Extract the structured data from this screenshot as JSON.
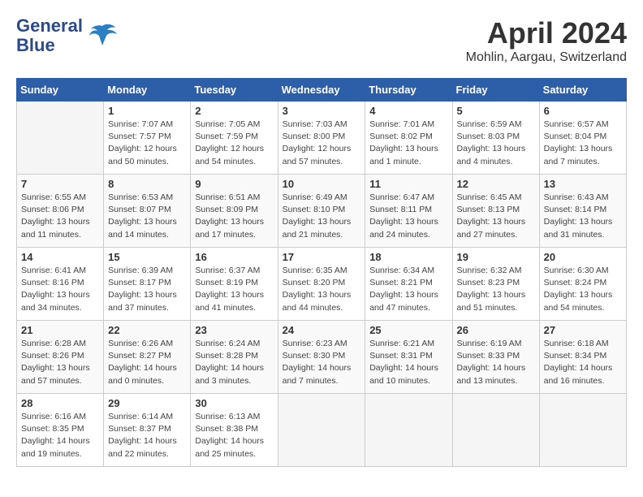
{
  "logo": {
    "line1": "General",
    "line2": "Blue"
  },
  "title": "April 2024",
  "subtitle": "Mohlin, Aargau, Switzerland",
  "days_header": [
    "Sunday",
    "Monday",
    "Tuesday",
    "Wednesday",
    "Thursday",
    "Friday",
    "Saturday"
  ],
  "weeks": [
    [
      {
        "day": "",
        "info": ""
      },
      {
        "day": "1",
        "info": "Sunrise: 7:07 AM\nSunset: 7:57 PM\nDaylight: 12 hours\nand 50 minutes."
      },
      {
        "day": "2",
        "info": "Sunrise: 7:05 AM\nSunset: 7:59 PM\nDaylight: 12 hours\nand 54 minutes."
      },
      {
        "day": "3",
        "info": "Sunrise: 7:03 AM\nSunset: 8:00 PM\nDaylight: 12 hours\nand 57 minutes."
      },
      {
        "day": "4",
        "info": "Sunrise: 7:01 AM\nSunset: 8:02 PM\nDaylight: 13 hours\nand 1 minute."
      },
      {
        "day": "5",
        "info": "Sunrise: 6:59 AM\nSunset: 8:03 PM\nDaylight: 13 hours\nand 4 minutes."
      },
      {
        "day": "6",
        "info": "Sunrise: 6:57 AM\nSunset: 8:04 PM\nDaylight: 13 hours\nand 7 minutes."
      }
    ],
    [
      {
        "day": "7",
        "info": "Sunrise: 6:55 AM\nSunset: 8:06 PM\nDaylight: 13 hours\nand 11 minutes."
      },
      {
        "day": "8",
        "info": "Sunrise: 6:53 AM\nSunset: 8:07 PM\nDaylight: 13 hours\nand 14 minutes."
      },
      {
        "day": "9",
        "info": "Sunrise: 6:51 AM\nSunset: 8:09 PM\nDaylight: 13 hours\nand 17 minutes."
      },
      {
        "day": "10",
        "info": "Sunrise: 6:49 AM\nSunset: 8:10 PM\nDaylight: 13 hours\nand 21 minutes."
      },
      {
        "day": "11",
        "info": "Sunrise: 6:47 AM\nSunset: 8:11 PM\nDaylight: 13 hours\nand 24 minutes."
      },
      {
        "day": "12",
        "info": "Sunrise: 6:45 AM\nSunset: 8:13 PM\nDaylight: 13 hours\nand 27 minutes."
      },
      {
        "day": "13",
        "info": "Sunrise: 6:43 AM\nSunset: 8:14 PM\nDaylight: 13 hours\nand 31 minutes."
      }
    ],
    [
      {
        "day": "14",
        "info": "Sunrise: 6:41 AM\nSunset: 8:16 PM\nDaylight: 13 hours\nand 34 minutes."
      },
      {
        "day": "15",
        "info": "Sunrise: 6:39 AM\nSunset: 8:17 PM\nDaylight: 13 hours\nand 37 minutes."
      },
      {
        "day": "16",
        "info": "Sunrise: 6:37 AM\nSunset: 8:19 PM\nDaylight: 13 hours\nand 41 minutes."
      },
      {
        "day": "17",
        "info": "Sunrise: 6:35 AM\nSunset: 8:20 PM\nDaylight: 13 hours\nand 44 minutes."
      },
      {
        "day": "18",
        "info": "Sunrise: 6:34 AM\nSunset: 8:21 PM\nDaylight: 13 hours\nand 47 minutes."
      },
      {
        "day": "19",
        "info": "Sunrise: 6:32 AM\nSunset: 8:23 PM\nDaylight: 13 hours\nand 51 minutes."
      },
      {
        "day": "20",
        "info": "Sunrise: 6:30 AM\nSunset: 8:24 PM\nDaylight: 13 hours\nand 54 minutes."
      }
    ],
    [
      {
        "day": "21",
        "info": "Sunrise: 6:28 AM\nSunset: 8:26 PM\nDaylight: 13 hours\nand 57 minutes."
      },
      {
        "day": "22",
        "info": "Sunrise: 6:26 AM\nSunset: 8:27 PM\nDaylight: 14 hours\nand 0 minutes."
      },
      {
        "day": "23",
        "info": "Sunrise: 6:24 AM\nSunset: 8:28 PM\nDaylight: 14 hours\nand 3 minutes."
      },
      {
        "day": "24",
        "info": "Sunrise: 6:23 AM\nSunset: 8:30 PM\nDaylight: 14 hours\nand 7 minutes."
      },
      {
        "day": "25",
        "info": "Sunrise: 6:21 AM\nSunset: 8:31 PM\nDaylight: 14 hours\nand 10 minutes."
      },
      {
        "day": "26",
        "info": "Sunrise: 6:19 AM\nSunset: 8:33 PM\nDaylight: 14 hours\nand 13 minutes."
      },
      {
        "day": "27",
        "info": "Sunrise: 6:18 AM\nSunset: 8:34 PM\nDaylight: 14 hours\nand 16 minutes."
      }
    ],
    [
      {
        "day": "28",
        "info": "Sunrise: 6:16 AM\nSunset: 8:35 PM\nDaylight: 14 hours\nand 19 minutes."
      },
      {
        "day": "29",
        "info": "Sunrise: 6:14 AM\nSunset: 8:37 PM\nDaylight: 14 hours\nand 22 minutes."
      },
      {
        "day": "30",
        "info": "Sunrise: 6:13 AM\nSunset: 8:38 PM\nDaylight: 14 hours\nand 25 minutes."
      },
      {
        "day": "",
        "info": ""
      },
      {
        "day": "",
        "info": ""
      },
      {
        "day": "",
        "info": ""
      },
      {
        "day": "",
        "info": ""
      }
    ]
  ]
}
